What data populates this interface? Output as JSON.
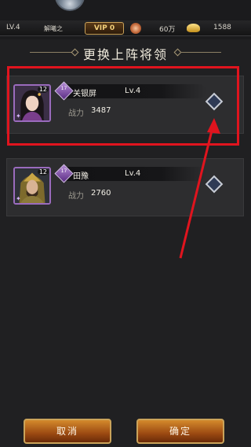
{
  "status": {
    "level": "LV.4",
    "player_name": "解曦之",
    "vip": "VIP 0",
    "coins": "60万",
    "gold": "1588"
  },
  "title": "更换上阵将领",
  "heroes": [
    {
      "name": "关银屏",
      "level": "Lv.4",
      "portrait_level": "12",
      "rank": "17",
      "power_label": "战力",
      "power": "3487",
      "selected": false
    },
    {
      "name": "田豫",
      "level": "Lv.4",
      "portrait_level": "12",
      "rank": "17",
      "power_label": "战力",
      "power": "2760",
      "selected": false
    }
  ],
  "buttons": {
    "cancel": "取消",
    "confirm": "确定"
  },
  "colors": {
    "highlight": "#e0141e",
    "rank_purple": "#9a6bbd",
    "button_gold": "#caa35a"
  }
}
